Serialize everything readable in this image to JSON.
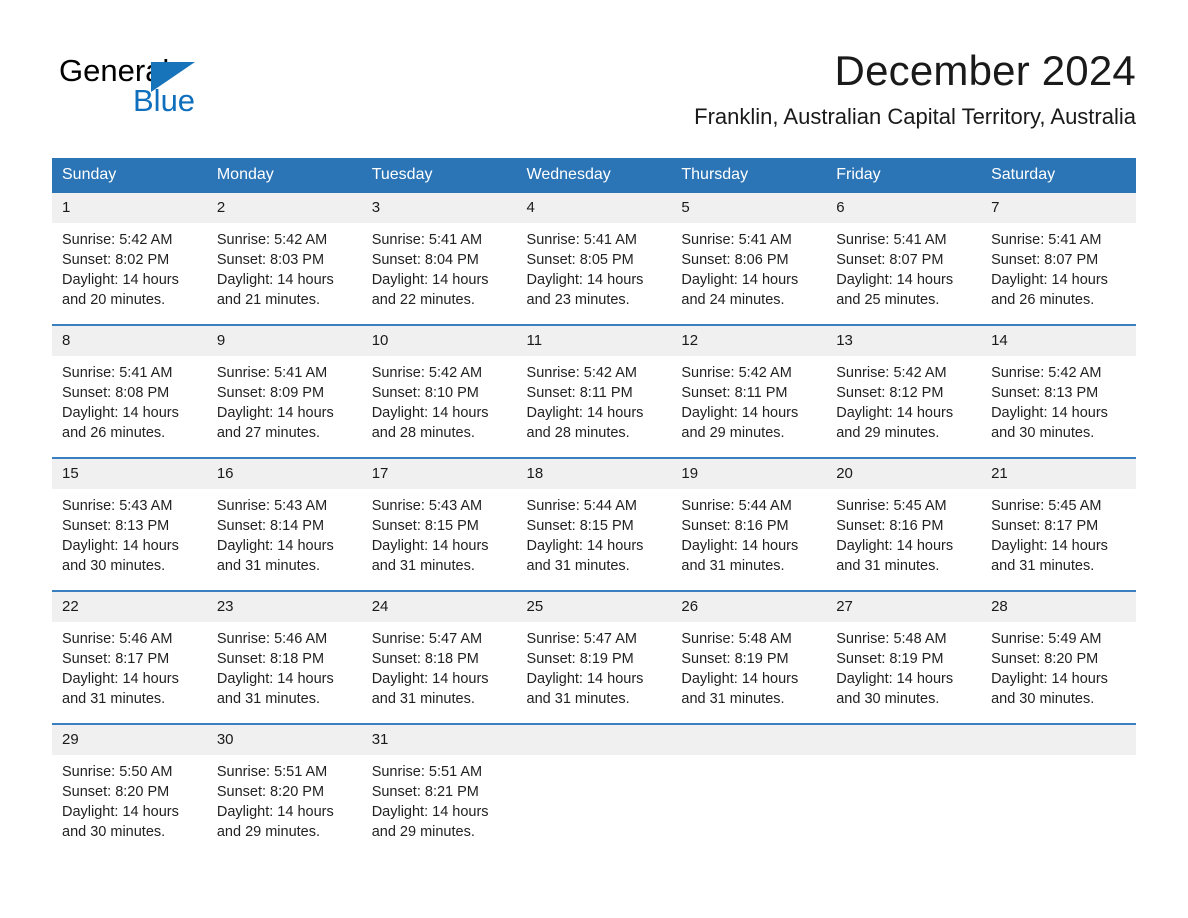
{
  "logo": {
    "word_one": "General",
    "word_two": "Blue",
    "triangle_color": "#1773ba",
    "blue_text_color": "#0f6fbd"
  },
  "header": {
    "month_title": "December 2024",
    "location": "Franklin, Australian Capital Territory, Australia",
    "header_bg_color": "#2b74b5",
    "header_text_color": "#ffffff",
    "row_divider_color": "#3a7fbf",
    "daynum_bg_color": "#f0f0f0"
  },
  "weekdays": [
    "Sunday",
    "Monday",
    "Tuesday",
    "Wednesday",
    "Thursday",
    "Friday",
    "Saturday"
  ],
  "weeks": [
    [
      {
        "day": "1",
        "sunrise": "Sunrise: 5:42 AM",
        "sunset": "Sunset: 8:02 PM",
        "daylight": "Daylight: 14 hours and 20 minutes."
      },
      {
        "day": "2",
        "sunrise": "Sunrise: 5:42 AM",
        "sunset": "Sunset: 8:03 PM",
        "daylight": "Daylight: 14 hours and 21 minutes."
      },
      {
        "day": "3",
        "sunrise": "Sunrise: 5:41 AM",
        "sunset": "Sunset: 8:04 PM",
        "daylight": "Daylight: 14 hours and 22 minutes."
      },
      {
        "day": "4",
        "sunrise": "Sunrise: 5:41 AM",
        "sunset": "Sunset: 8:05 PM",
        "daylight": "Daylight: 14 hours and 23 minutes."
      },
      {
        "day": "5",
        "sunrise": "Sunrise: 5:41 AM",
        "sunset": "Sunset: 8:06 PM",
        "daylight": "Daylight: 14 hours and 24 minutes."
      },
      {
        "day": "6",
        "sunrise": "Sunrise: 5:41 AM",
        "sunset": "Sunset: 8:07 PM",
        "daylight": "Daylight: 14 hours and 25 minutes."
      },
      {
        "day": "7",
        "sunrise": "Sunrise: 5:41 AM",
        "sunset": "Sunset: 8:07 PM",
        "daylight": "Daylight: 14 hours and 26 minutes."
      }
    ],
    [
      {
        "day": "8",
        "sunrise": "Sunrise: 5:41 AM",
        "sunset": "Sunset: 8:08 PM",
        "daylight": "Daylight: 14 hours and 26 minutes."
      },
      {
        "day": "9",
        "sunrise": "Sunrise: 5:41 AM",
        "sunset": "Sunset: 8:09 PM",
        "daylight": "Daylight: 14 hours and 27 minutes."
      },
      {
        "day": "10",
        "sunrise": "Sunrise: 5:42 AM",
        "sunset": "Sunset: 8:10 PM",
        "daylight": "Daylight: 14 hours and 28 minutes."
      },
      {
        "day": "11",
        "sunrise": "Sunrise: 5:42 AM",
        "sunset": "Sunset: 8:11 PM",
        "daylight": "Daylight: 14 hours and 28 minutes."
      },
      {
        "day": "12",
        "sunrise": "Sunrise: 5:42 AM",
        "sunset": "Sunset: 8:11 PM",
        "daylight": "Daylight: 14 hours and 29 minutes."
      },
      {
        "day": "13",
        "sunrise": "Sunrise: 5:42 AM",
        "sunset": "Sunset: 8:12 PM",
        "daylight": "Daylight: 14 hours and 29 minutes."
      },
      {
        "day": "14",
        "sunrise": "Sunrise: 5:42 AM",
        "sunset": "Sunset: 8:13 PM",
        "daylight": "Daylight: 14 hours and 30 minutes."
      }
    ],
    [
      {
        "day": "15",
        "sunrise": "Sunrise: 5:43 AM",
        "sunset": "Sunset: 8:13 PM",
        "daylight": "Daylight: 14 hours and 30 minutes."
      },
      {
        "day": "16",
        "sunrise": "Sunrise: 5:43 AM",
        "sunset": "Sunset: 8:14 PM",
        "daylight": "Daylight: 14 hours and 31 minutes."
      },
      {
        "day": "17",
        "sunrise": "Sunrise: 5:43 AM",
        "sunset": "Sunset: 8:15 PM",
        "daylight": "Daylight: 14 hours and 31 minutes."
      },
      {
        "day": "18",
        "sunrise": "Sunrise: 5:44 AM",
        "sunset": "Sunset: 8:15 PM",
        "daylight": "Daylight: 14 hours and 31 minutes."
      },
      {
        "day": "19",
        "sunrise": "Sunrise: 5:44 AM",
        "sunset": "Sunset: 8:16 PM",
        "daylight": "Daylight: 14 hours and 31 minutes."
      },
      {
        "day": "20",
        "sunrise": "Sunrise: 5:45 AM",
        "sunset": "Sunset: 8:16 PM",
        "daylight": "Daylight: 14 hours and 31 minutes."
      },
      {
        "day": "21",
        "sunrise": "Sunrise: 5:45 AM",
        "sunset": "Sunset: 8:17 PM",
        "daylight": "Daylight: 14 hours and 31 minutes."
      }
    ],
    [
      {
        "day": "22",
        "sunrise": "Sunrise: 5:46 AM",
        "sunset": "Sunset: 8:17 PM",
        "daylight": "Daylight: 14 hours and 31 minutes."
      },
      {
        "day": "23",
        "sunrise": "Sunrise: 5:46 AM",
        "sunset": "Sunset: 8:18 PM",
        "daylight": "Daylight: 14 hours and 31 minutes."
      },
      {
        "day": "24",
        "sunrise": "Sunrise: 5:47 AM",
        "sunset": "Sunset: 8:18 PM",
        "daylight": "Daylight: 14 hours and 31 minutes."
      },
      {
        "day": "25",
        "sunrise": "Sunrise: 5:47 AM",
        "sunset": "Sunset: 8:19 PM",
        "daylight": "Daylight: 14 hours and 31 minutes."
      },
      {
        "day": "26",
        "sunrise": "Sunrise: 5:48 AM",
        "sunset": "Sunset: 8:19 PM",
        "daylight": "Daylight: 14 hours and 31 minutes."
      },
      {
        "day": "27",
        "sunrise": "Sunrise: 5:48 AM",
        "sunset": "Sunset: 8:19 PM",
        "daylight": "Daylight: 14 hours and 30 minutes."
      },
      {
        "day": "28",
        "sunrise": "Sunrise: 5:49 AM",
        "sunset": "Sunset: 8:20 PM",
        "daylight": "Daylight: 14 hours and 30 minutes."
      }
    ],
    [
      {
        "day": "29",
        "sunrise": "Sunrise: 5:50 AM",
        "sunset": "Sunset: 8:20 PM",
        "daylight": "Daylight: 14 hours and 30 minutes."
      },
      {
        "day": "30",
        "sunrise": "Sunrise: 5:51 AM",
        "sunset": "Sunset: 8:20 PM",
        "daylight": "Daylight: 14 hours and 29 minutes."
      },
      {
        "day": "31",
        "sunrise": "Sunrise: 5:51 AM",
        "sunset": "Sunset: 8:21 PM",
        "daylight": "Daylight: 14 hours and 29 minutes."
      },
      {
        "day": "",
        "sunrise": "",
        "sunset": "",
        "daylight": ""
      },
      {
        "day": "",
        "sunrise": "",
        "sunset": "",
        "daylight": ""
      },
      {
        "day": "",
        "sunrise": "",
        "sunset": "",
        "daylight": ""
      },
      {
        "day": "",
        "sunrise": "",
        "sunset": "",
        "daylight": ""
      }
    ]
  ]
}
